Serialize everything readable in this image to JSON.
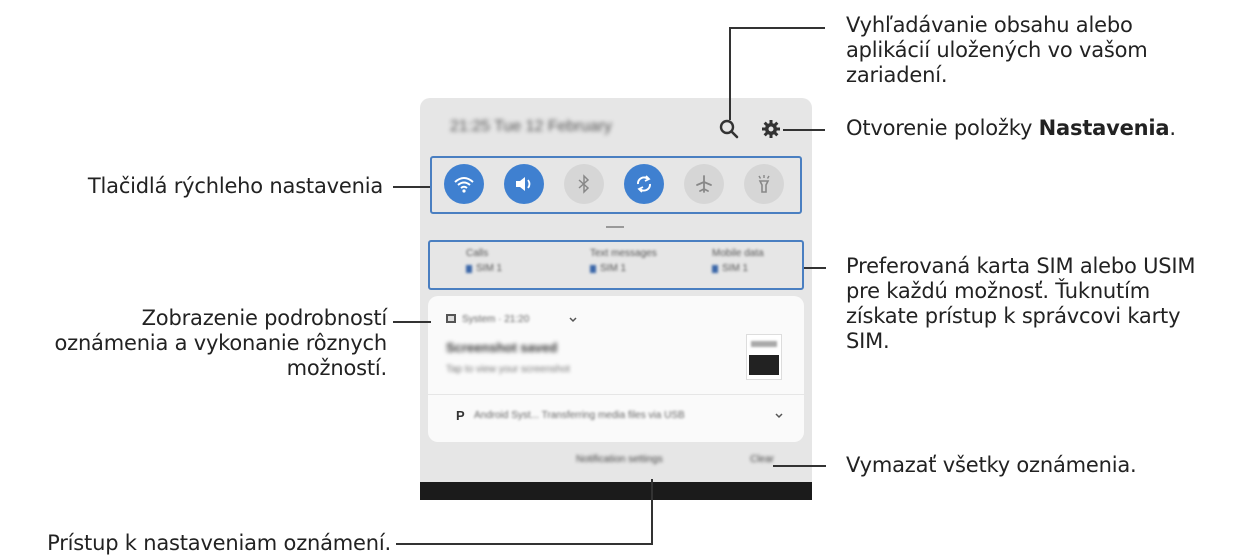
{
  "callouts": {
    "search": [
      "Vyhľadávanie obsahu alebo",
      "aplikácií uložených vo vašom",
      "zariadení."
    ],
    "settings_prefix": "Otvorenie položky ",
    "settings_bold": "Nastavenia",
    "settings_suffix": ".",
    "quick_settings": "Tlačidlá rýchleho nastavenia",
    "sim": [
      "Preferovaná karta SIM alebo USIM",
      "pre každú možnosť. Ťuknutím",
      "získate prístup k správcovi karty",
      "SIM."
    ],
    "notification_details": [
      "Zobrazenie podrobností",
      "oznámenia a vykonanie rôznych",
      "možností."
    ],
    "clear_all": "Vymazať všetky oznámenia.",
    "notification_settings": "Prístup k nastaveniam oznámení."
  },
  "panel": {
    "status_time": "21:25  Tue 12 February",
    "quick_settings": [
      {
        "icon": "wifi-icon",
        "state": "on"
      },
      {
        "icon": "sound-icon",
        "state": "on"
      },
      {
        "icon": "bluetooth-icon",
        "state": "off"
      },
      {
        "icon": "auto-rotate-icon",
        "state": "on"
      },
      {
        "icon": "airplane-icon",
        "state": "off"
      },
      {
        "icon": "flashlight-icon",
        "state": "off"
      }
    ],
    "sim_options": [
      {
        "label": "Calls",
        "sim": "SIM 1"
      },
      {
        "label": "Text messages",
        "sim": "SIM 1"
      },
      {
        "label": "Mobile data",
        "sim": "SIM 1"
      }
    ],
    "notification": {
      "app": "System · 21:20",
      "title": "Screenshot saved",
      "text": "Tap to view your screenshot"
    },
    "notification2": {
      "p": "P",
      "text": "Android Syst...   Transferring media files via USB"
    },
    "footer": {
      "settings": "Notification settings",
      "clear": "Clear"
    }
  },
  "colors": {
    "accent": "#3f80d0",
    "highlight_border": "#4a7fc1"
  }
}
